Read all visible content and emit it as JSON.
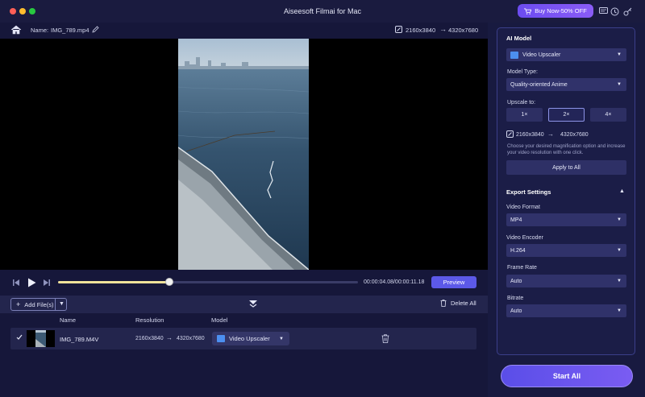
{
  "window": {
    "title": "Aiseesoft Filmai for Mac",
    "buy_label": "Buy Now-50% OFF"
  },
  "file": {
    "name_label": "Name:",
    "name_value": "IMG_789.mp4",
    "res_from": "2160x3840",
    "res_to": "4320x7680"
  },
  "playback": {
    "progress": 0.37,
    "time": "00:00:04.08/00:00:11.18",
    "preview_label": "Preview"
  },
  "list": {
    "add_files_label": "Add File(s)",
    "delete_all_label": "Delete All",
    "columns": {
      "name": "Name",
      "resolution": "Resolution",
      "model": "Model"
    },
    "rows": [
      {
        "name": "IMG_789.M4V",
        "res_from": "2160x3840",
        "res_to": "4320x7680",
        "model": "Video Upscaler"
      }
    ]
  },
  "ai_model": {
    "title": "AI Model",
    "model_value": "Video Upscaler",
    "model_type_label": "Model Type:",
    "model_type_value": "Quality-oriented Anime",
    "upscale_label": "Upscale to:",
    "scale_options": [
      "1×",
      "2×",
      "4×"
    ],
    "selected_scale": "2×",
    "res_from": "2160x3840",
    "res_to": "4320x7680",
    "hint": "Choose your desired magnification option and increase your video resolution with one click.",
    "apply_label": "Apply to All"
  },
  "export": {
    "title": "Export Settings",
    "video_format_label": "Video Format",
    "video_format_value": "MP4",
    "video_encoder_label": "Video Encoder",
    "video_encoder_value": "H.264",
    "frame_rate_label": "Frame Rate",
    "frame_rate_value": "Auto",
    "bitrate_label": "Bitrate",
    "bitrate_value": "Auto"
  },
  "start_all_label": "Start All",
  "colors": {
    "accent": "#5c59e8",
    "progress": "#f0e29a",
    "panel_border": "#3b3f8a"
  }
}
